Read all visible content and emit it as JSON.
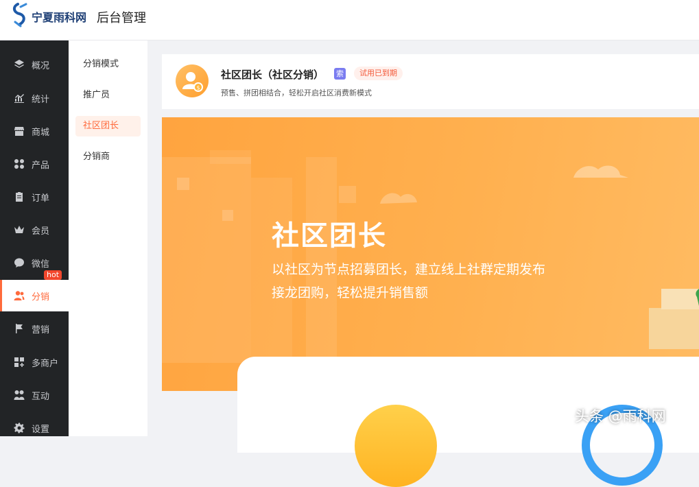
{
  "header": {
    "logo_text": "宁夏雨科网",
    "app_title": "后台管理"
  },
  "sidebar": {
    "items": [
      {
        "label": "概况",
        "icon": "layers-icon"
      },
      {
        "label": "统计",
        "icon": "chart-icon"
      },
      {
        "label": "商城",
        "icon": "shop-icon"
      },
      {
        "label": "产品",
        "icon": "product-icon"
      },
      {
        "label": "订单",
        "icon": "order-icon"
      },
      {
        "label": "会员",
        "icon": "crown-icon"
      },
      {
        "label": "微信",
        "icon": "wechat-icon"
      },
      {
        "label": "分销",
        "icon": "users-icon",
        "active": true
      },
      {
        "label": "营销",
        "icon": "flag-icon",
        "badge": "hot"
      },
      {
        "label": "多商户",
        "icon": "merchant-icon"
      },
      {
        "label": "互动",
        "icon": "interact-icon"
      },
      {
        "label": "设置",
        "icon": "gear-icon"
      }
    ]
  },
  "submenu": {
    "items": [
      {
        "label": "分销模式"
      },
      {
        "label": "推广员"
      },
      {
        "label": "社区团长",
        "active": true
      },
      {
        "label": "分销商"
      }
    ]
  },
  "card": {
    "title": "社区团长（社区分销）",
    "lock_glyph": "索",
    "status_tag": "试用已到期",
    "description": "预售、拼团相结合，轻松开启社区消费新模式"
  },
  "banner": {
    "title": "社区团长",
    "subtitle": "以社区为节点招募团长，建立线上社群定期发布接龙团购，轻松提升销售额"
  },
  "watermark": "头条 @雨科网",
  "colors": {
    "accent": "#ff6a3c",
    "sidebar_bg": "#222426",
    "banner_orange": "#ffa43f",
    "hot_red": "#f2472d"
  }
}
